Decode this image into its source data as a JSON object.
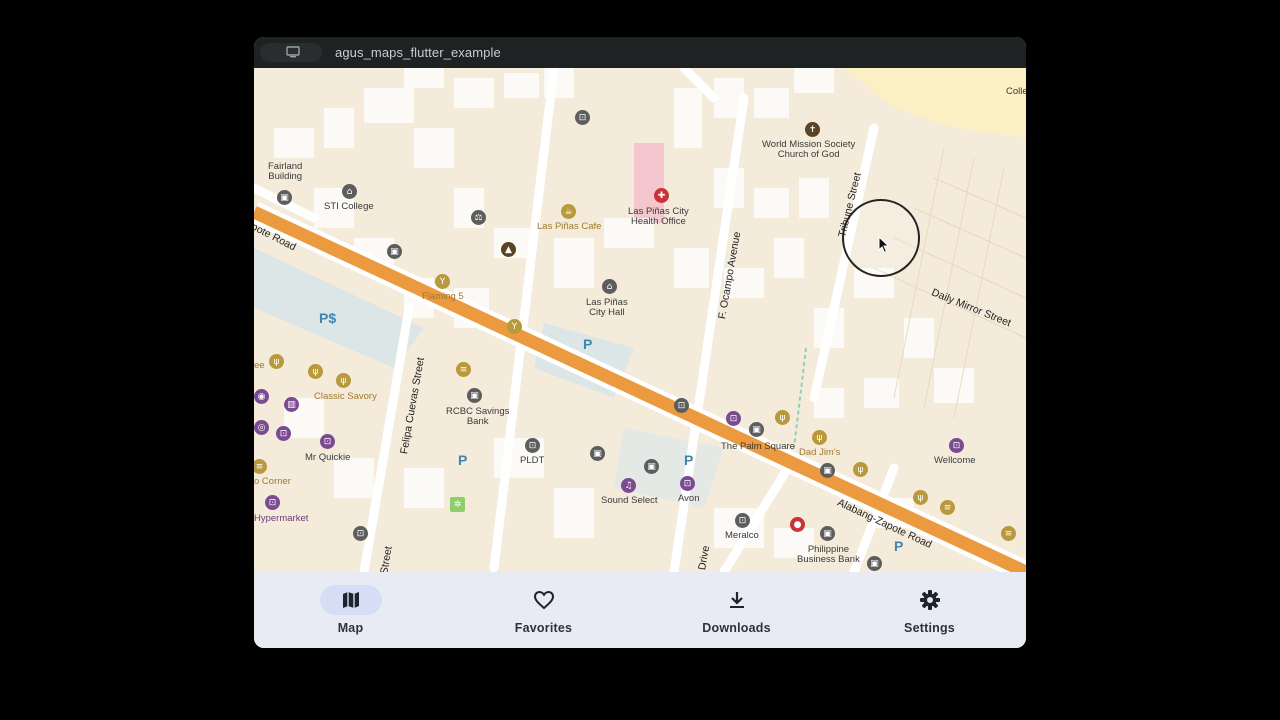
{
  "window": {
    "title": "agus_maps_flutter_example"
  },
  "map": {
    "places": {
      "fairland": "Fairland\nBuilding",
      "sti": "STI College",
      "cafe": "Las Piñas Cafe",
      "health": "Las Piñas City\nHealth Office",
      "church": "World Mission Society\nChurch of God",
      "flaming": "Flaming 5",
      "cityhall": "Las Piñas\nCity Hall",
      "classic": "Classic Savory",
      "rcbc": "RCBC Savings\nBank",
      "quickie": "Mr Quickie",
      "corner": "o Corner",
      "hyper": "Hypermarket",
      "pldt": "PLDT",
      "soundselect": "Sound Select",
      "avon": "Avon",
      "palm": "The Palm Square",
      "dadjims": "Dad Jim's",
      "wellcome": "Wellcome",
      "meralco": "Meralco",
      "philbank": "Philippine\nBusiness Bank",
      "colle": "Colle",
      "ee": "ee"
    },
    "streets": {
      "zapote_left": "pote Road",
      "tribune": "Tribune Street",
      "ocampo": "F. Ocampo Avenue",
      "dailymirror": "Daily Mirror Street",
      "felipa": "Felipa Cuevas Street",
      "alabang": "Alabang-Zapote Road",
      "street_bottom": "Street",
      "drive": "Drive"
    },
    "parking_label": "P",
    "parking_paid": "P$"
  },
  "nav": {
    "items": [
      {
        "label": "Map",
        "icon": "map-icon",
        "active": true
      },
      {
        "label": "Favorites",
        "icon": "heart-icon",
        "active": false
      },
      {
        "label": "Downloads",
        "icon": "download-icon",
        "active": false
      },
      {
        "label": "Settings",
        "icon": "gear-icon",
        "active": false
      }
    ]
  },
  "colors": {
    "main_road": "#ec9a3f",
    "background": "#000000",
    "navbar": "#e9ebf4",
    "active_indicator": "#d6def6"
  }
}
